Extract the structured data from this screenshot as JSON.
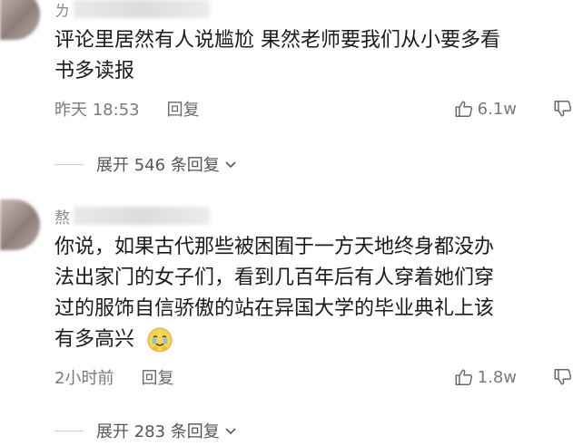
{
  "comments": [
    {
      "username": "ㄌ",
      "text_line1": "评论里居然有人说尴尬 果然老师要我们从小要多看",
      "text_line2": "书多读报",
      "time": "昨天 18:53",
      "reply_label": "回复",
      "likes": "6.1w",
      "expand_label": "展开 546 条回复"
    },
    {
      "username": "熬",
      "text_line1": "你说，如果古代那些被困囿于一方天地终身都没办",
      "text_line2": "法出家门的女子们，看到几百年后有人穿着她们穿",
      "text_line3": "过的服饰自信骄傲的站在异国大学的毕业典礼上该",
      "text_line4": "有多高兴",
      "emoji": "crying-happy-emoji",
      "time": "2小时前",
      "reply_label": "回复",
      "likes": "1.8w",
      "expand_label": "展开 283 条回复"
    }
  ],
  "icons": {
    "like": "thumbs-up-icon",
    "dislike": "thumbs-down-icon",
    "expand": "chevron-down-icon"
  },
  "colors": {
    "text": "#1a1a1a",
    "meta": "#7a7a7a"
  }
}
